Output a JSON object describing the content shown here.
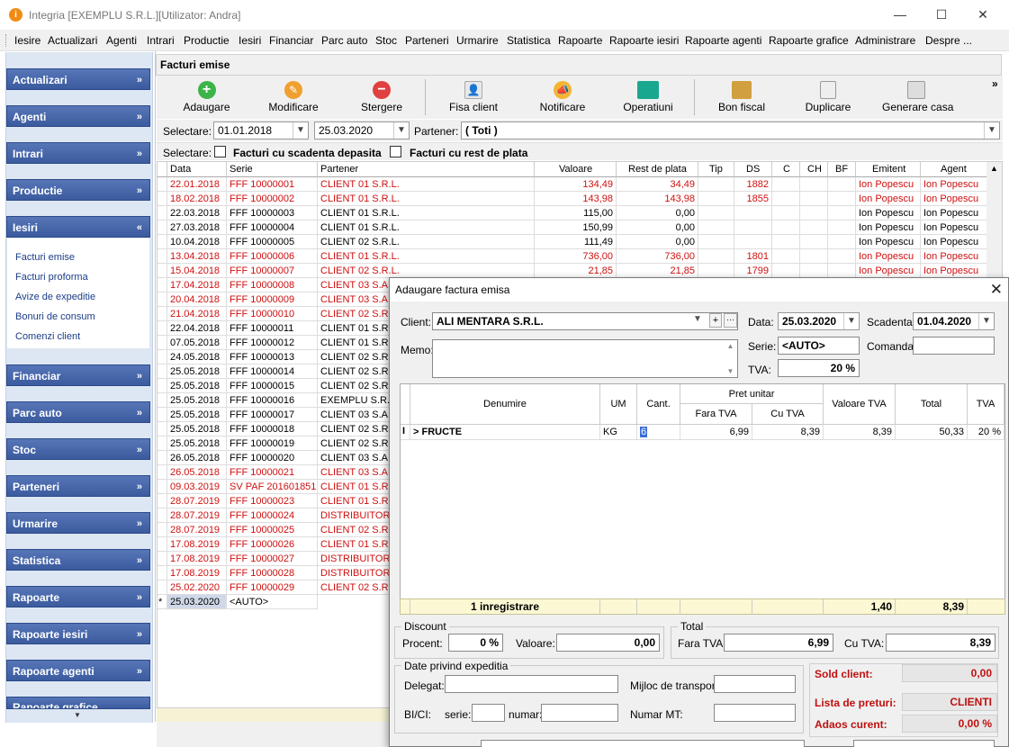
{
  "window": {
    "title": "Integria [EXEMPLU S.R.L.][Utilizator: Andra]",
    "app_icon_letter": "i",
    "min": "—",
    "max": "☐",
    "close": "✕"
  },
  "menu": [
    "Iesire",
    "Actualizari",
    "Agenti",
    "Intrari",
    "Productie",
    "Iesiri",
    "Financiar",
    "Parc auto",
    "Stoc",
    "Parteneri",
    "Urmarire",
    "Statistica",
    "Rapoarte",
    "Rapoarte iesiri",
    "Rapoarte agenti",
    "Rapoarte grafice",
    "Administrare",
    "Despre ..."
  ],
  "sidebar": {
    "groups": [
      "Actualizari",
      "Agenti",
      "Intrari",
      "Productie",
      "Iesiri",
      "Financiar",
      "Parc auto",
      "Stoc",
      "Parteneri",
      "Urmarire",
      "Statistica",
      "Rapoarte",
      "Rapoarte iesiri",
      "Rapoarte agenti",
      "Rapoarte grafice"
    ],
    "iesiri_items": [
      "Facturi emise",
      "Facturi proforma",
      "Avize de expeditie",
      "Bonuri de consum",
      "Comenzi client"
    ],
    "chevron_down": "»",
    "chevron_up": "«"
  },
  "document": {
    "title": "Facturi emise"
  },
  "toolbar": {
    "buttons": [
      "Adaugare",
      "Modificare",
      "Stergere",
      "Fisa client",
      "Notificare",
      "Operatiuni",
      "Bon fiscal",
      "Duplicare",
      "Generare casa"
    ],
    "more": "»"
  },
  "filters": {
    "selectare_label": "Selectare:",
    "date_from": "01.01.2018",
    "date_to": "25.03.2020",
    "partener_label": "Partener:",
    "partener_value": "( Toti )",
    "selectare2_label": "Selectare:",
    "scadenta_label": "Facturi cu scadenta depasita",
    "rest_label": "Facturi cu rest de plata"
  },
  "grid": {
    "columns": [
      "Data",
      "Serie",
      "Partener",
      "Valoare",
      "Rest de plata",
      "Tip",
      "DS",
      "C",
      "CH",
      "BF",
      "Emitent",
      "Agent"
    ],
    "rows": [
      {
        "data": "22.01.2018",
        "serie": "FFF 10000001",
        "partener": "CLIENT 01 S.R.L.",
        "valoare": "134,49",
        "rest": "34,49",
        "ds": "1882",
        "emitent": "Ion Popescu",
        "agent": "Ion Popescu",
        "red": true
      },
      {
        "data": "18.02.2018",
        "serie": "FFF 10000002",
        "partener": "CLIENT 01 S.R.L.",
        "valoare": "143,98",
        "rest": "143,98",
        "ds": "1855",
        "emitent": "Ion Popescu",
        "agent": "Ion Popescu",
        "red": true
      },
      {
        "data": "22.03.2018",
        "serie": "FFF 10000003",
        "partener": "CLIENT 01 S.R.L.",
        "valoare": "115,00",
        "rest": "0,00",
        "ds": "",
        "emitent": "Ion Popescu",
        "agent": "Ion Popescu",
        "red": false
      },
      {
        "data": "27.03.2018",
        "serie": "FFF 10000004",
        "partener": "CLIENT 01 S.R.L.",
        "valoare": "150,99",
        "rest": "0,00",
        "ds": "",
        "emitent": "Ion Popescu",
        "agent": "Ion Popescu",
        "red": false
      },
      {
        "data": "10.04.2018",
        "serie": "FFF 10000005",
        "partener": "CLIENT 02 S.R.L.",
        "valoare": "111,49",
        "rest": "0,00",
        "ds": "",
        "emitent": "Ion Popescu",
        "agent": "Ion Popescu",
        "red": false
      },
      {
        "data": "13.04.2018",
        "serie": "FFF 10000006",
        "partener": "CLIENT 01 S.R.L.",
        "valoare": "736,00",
        "rest": "736,00",
        "ds": "1801",
        "emitent": "Ion Popescu",
        "agent": "Ion Popescu",
        "red": true
      },
      {
        "data": "15.04.2018",
        "serie": "FFF 10000007",
        "partener": "CLIENT 02 S.R.L.",
        "valoare": "21,85",
        "rest": "21,85",
        "ds": "1799",
        "emitent": "Ion Popescu",
        "agent": "Ion Popescu",
        "red": true
      },
      {
        "data": "17.04.2018",
        "serie": "FFF 10000008",
        "partener": "CLIENT 03 S.A.",
        "valoare": "",
        "rest": "",
        "ds": "",
        "emitent": "",
        "agent": "",
        "red": true
      },
      {
        "data": "20.04.2018",
        "serie": "FFF 10000009",
        "partener": "CLIENT 03 S.A.",
        "valoare": "",
        "rest": "",
        "ds": "",
        "emitent": "",
        "agent": "",
        "red": true
      },
      {
        "data": "21.04.2018",
        "serie": "FFF 10000010",
        "partener": "CLIENT 02 S.R.",
        "valoare": "",
        "rest": "",
        "ds": "",
        "emitent": "",
        "agent": "",
        "red": true
      },
      {
        "data": "22.04.2018",
        "serie": "FFF 10000011",
        "partener": "CLIENT 01 S.R.",
        "valoare": "",
        "rest": "",
        "ds": "",
        "emitent": "",
        "agent": "",
        "red": false
      },
      {
        "data": "07.05.2018",
        "serie": "FFF 10000012",
        "partener": "CLIENT 01 S.R.",
        "valoare": "",
        "rest": "",
        "ds": "",
        "emitent": "",
        "agent": "",
        "red": false
      },
      {
        "data": "24.05.2018",
        "serie": "FFF 10000013",
        "partener": "CLIENT 02 S.R.",
        "valoare": "",
        "rest": "",
        "ds": "",
        "emitent": "",
        "agent": "",
        "red": false
      },
      {
        "data": "25.05.2018",
        "serie": "FFF 10000014",
        "partener": "CLIENT 02 S.R.",
        "valoare": "",
        "rest": "",
        "ds": "",
        "emitent": "",
        "agent": "",
        "red": false
      },
      {
        "data": "25.05.2018",
        "serie": "FFF 10000015",
        "partener": "CLIENT 02 S.R.",
        "valoare": "",
        "rest": "",
        "ds": "",
        "emitent": "",
        "agent": "",
        "red": false
      },
      {
        "data": "25.05.2018",
        "serie": "FFF 10000016",
        "partener": "EXEMPLU S.R.L.",
        "valoare": "",
        "rest": "",
        "ds": "",
        "emitent": "",
        "agent": "",
        "red": false
      },
      {
        "data": "25.05.2018",
        "serie": "FFF 10000017",
        "partener": "CLIENT 03 S.A.",
        "valoare": "",
        "rest": "",
        "ds": "",
        "emitent": "",
        "agent": "",
        "red": false
      },
      {
        "data": "25.05.2018",
        "serie": "FFF 10000018",
        "partener": "CLIENT 02 S.R.",
        "valoare": "",
        "rest": "",
        "ds": "",
        "emitent": "",
        "agent": "",
        "red": false
      },
      {
        "data": "25.05.2018",
        "serie": "FFF 10000019",
        "partener": "CLIENT 02 S.R.",
        "valoare": "",
        "rest": "",
        "ds": "",
        "emitent": "",
        "agent": "",
        "red": false
      },
      {
        "data": "26.05.2018",
        "serie": "FFF 10000020",
        "partener": "CLIENT 03 S.A.",
        "valoare": "",
        "rest": "",
        "ds": "",
        "emitent": "",
        "agent": "",
        "red": false
      },
      {
        "data": "26.05.2018",
        "serie": "FFF 10000021",
        "partener": "CLIENT 03 S.A.",
        "valoare": "",
        "rest": "",
        "ds": "",
        "emitent": "",
        "agent": "",
        "red": true
      },
      {
        "data": "09.03.2019",
        "serie": "SV PAF 201601851",
        "partener": "CLIENT 01 S.R.",
        "valoare": "",
        "rest": "",
        "ds": "",
        "emitent": "",
        "agent": "",
        "red": true
      },
      {
        "data": "28.07.2019",
        "serie": "FFF 10000023",
        "partener": "CLIENT 01 S.R.",
        "valoare": "",
        "rest": "",
        "ds": "",
        "emitent": "",
        "agent": "",
        "red": true
      },
      {
        "data": "28.07.2019",
        "serie": "FFF 10000024",
        "partener": "DISTRIBUITOR",
        "valoare": "",
        "rest": "",
        "ds": "",
        "emitent": "",
        "agent": "",
        "red": true
      },
      {
        "data": "28.07.2019",
        "serie": "FFF 10000025",
        "partener": "CLIENT 02 S.R.",
        "valoare": "",
        "rest": "",
        "ds": "",
        "emitent": "",
        "agent": "",
        "red": true
      },
      {
        "data": "17.08.2019",
        "serie": "FFF 10000026",
        "partener": "CLIENT 01 S.R.",
        "valoare": "",
        "rest": "",
        "ds": "",
        "emitent": "",
        "agent": "",
        "red": true
      },
      {
        "data": "17.08.2019",
        "serie": "FFF 10000027",
        "partener": "DISTRIBUITOR",
        "valoare": "",
        "rest": "",
        "ds": "",
        "emitent": "",
        "agent": "",
        "red": true
      },
      {
        "data": "17.08.2019",
        "serie": "FFF 10000028",
        "partener": "DISTRIBUITOR",
        "valoare": "",
        "rest": "",
        "ds": "",
        "emitent": "",
        "agent": "",
        "red": true
      },
      {
        "data": "25.02.2020",
        "serie": "FFF 10000029",
        "partener": "CLIENT 02 S.R.",
        "valoare": "",
        "rest": "",
        "ds": "",
        "emitent": "",
        "agent": "",
        "red": true
      }
    ],
    "new_row": {
      "marker": "*",
      "data": "25.03.2020",
      "serie": "<AUTO>"
    }
  },
  "dialog": {
    "title": "Adaugare factura emisa",
    "client_label": "Client:",
    "client_value": "ALI MENTARA S.R.L.",
    "memo_label": "Memo:",
    "data_label": "Data:",
    "data_value": "25.03.2020",
    "scadenta_label": "Scadenta:",
    "scadenta_value": "01.04.2020",
    "serie_label": "Serie:",
    "serie_value": "<AUTO>",
    "comanda_label": "Comanda:",
    "tva_label": "TVA:",
    "tva_value": "20 %",
    "lines": {
      "headers": {
        "denumire": "Denumire",
        "um": "UM",
        "cant": "Cant.",
        "pret": "Pret unitar",
        "fara": "Fara TVA",
        "cu": "Cu TVA",
        "valtva": "Valoare TVA",
        "total": "Total",
        "tva": "TVA"
      },
      "row": {
        "cursor": "I",
        "denumire": "> FRUCTE",
        "um": "KG",
        "cant": "6",
        "fara": "6,99",
        "cu": "8,39",
        "valtva": "8,39",
        "total": "50,33",
        "tva": "20 %"
      },
      "totals": {
        "count": "1 inregistrare",
        "valtva": "1,40",
        "total": "8,39"
      }
    },
    "discount": {
      "title": "Discount",
      "procent_label": "Procent:",
      "procent": "0 %",
      "valoare_label": "Valoare:",
      "valoare": "0,00"
    },
    "total": {
      "title": "Total",
      "fara_label": "Fara TVA:",
      "fara": "6,99",
      "cu_label": "Cu TVA:",
      "cu": "8,39"
    },
    "expeditie": {
      "title": "Date privind expeditia",
      "delegat": "Delegat:",
      "mijloc": "Mijloc de transport:",
      "bici": "BI/CI:",
      "serie": "serie:",
      "numar": "numar:",
      "numar_mt": "Numar MT:"
    },
    "summary": {
      "sold_label": "Sold client:",
      "sold": "0,00",
      "lista_label": "Lista de preturi:",
      "lista": "CLIENTI",
      "adaos_label": "Adaos curent:",
      "adaos": "0,00 %"
    }
  }
}
